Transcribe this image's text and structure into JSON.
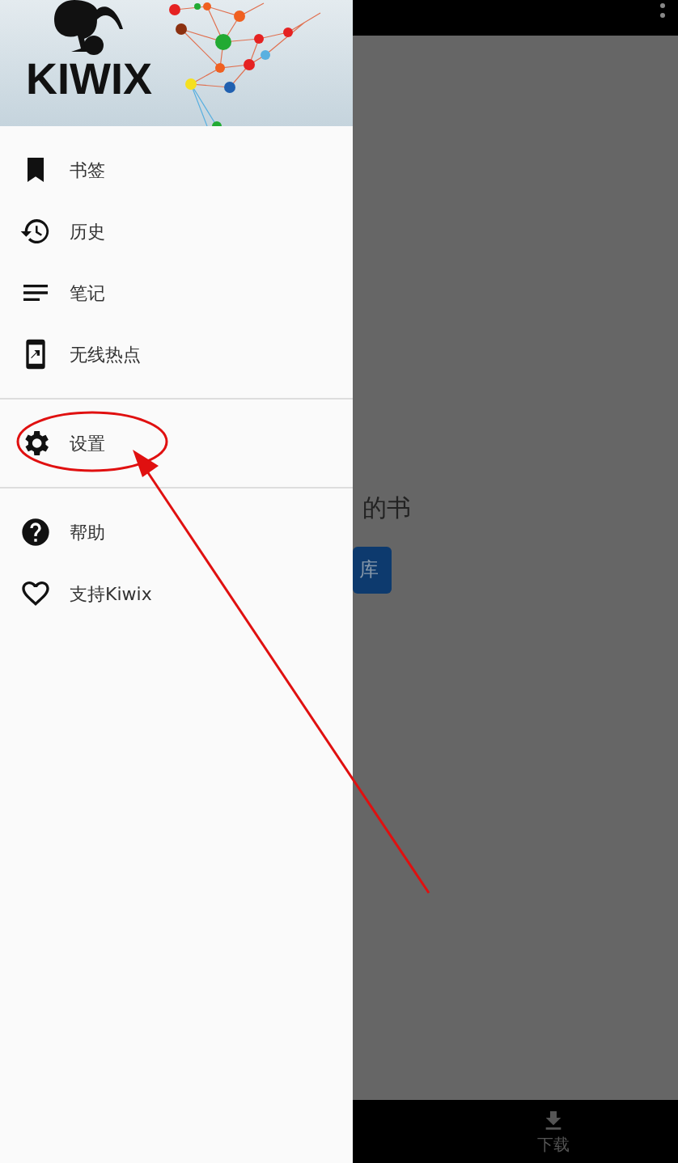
{
  "drawer": {
    "logo": "KIWIX",
    "sections": [
      {
        "items": [
          {
            "label": "书签"
          },
          {
            "label": "历史"
          },
          {
            "label": "笔记"
          },
          {
            "label": "无线热点"
          }
        ]
      },
      {
        "items": [
          {
            "label": "设置"
          }
        ]
      },
      {
        "items": [
          {
            "label": "帮助"
          },
          {
            "label": "支持Kiwix"
          }
        ]
      }
    ]
  },
  "content": {
    "message": "的书",
    "button": "库"
  },
  "bottom_nav": [
    {
      "label": "下载"
    }
  ]
}
